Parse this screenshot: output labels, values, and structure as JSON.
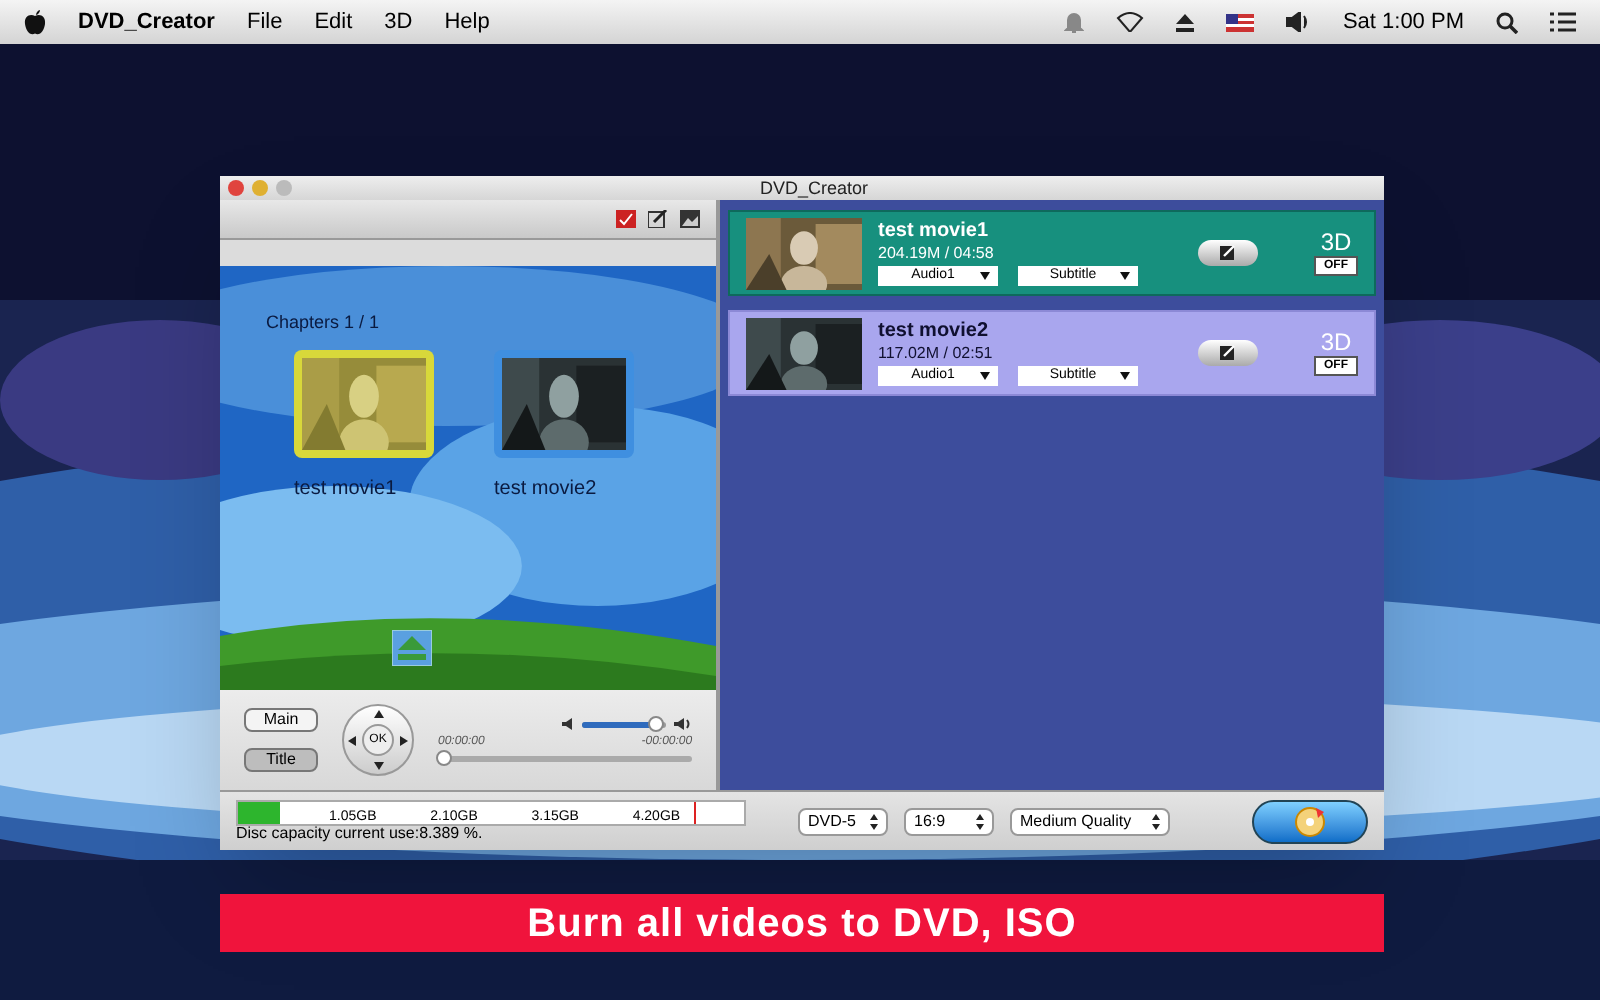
{
  "menu_bar": {
    "app_name": "DVD_Creator",
    "menus": [
      "File",
      "Edit",
      "3D",
      "Help"
    ],
    "clock": "Sat 1:00 PM"
  },
  "window": {
    "title": "DVD_Creator"
  },
  "preview": {
    "chapters": "Chapters 1 / 1",
    "thumbnails": [
      {
        "label": "test movie1",
        "selected": true
      },
      {
        "label": "test movie2",
        "selected": false
      }
    ]
  },
  "controls": {
    "buttons": [
      {
        "label": "Main",
        "selected": false
      },
      {
        "label": "Title",
        "selected": true
      }
    ],
    "ok": "OK",
    "volume": {
      "level": 0.88
    },
    "elapsed": "00:00:00",
    "remaining": "-00:00:00",
    "progress": {
      "level": 0
    }
  },
  "movies": [
    {
      "title": "test movie1",
      "info": "204.19M / 04:58",
      "audio": "Audio1",
      "subtitle": "Subtitle",
      "mode": "3D",
      "toggle": "OFF",
      "selected": true
    },
    {
      "title": "test movie2",
      "info": "117.02M / 02:51",
      "audio": "Audio1",
      "subtitle": "Subtitle",
      "mode": "3D",
      "toggle": "OFF",
      "selected": false
    }
  ],
  "disc": {
    "ticks": [
      "1.05GB",
      "2.10GB",
      "3.15GB",
      "4.20GB"
    ],
    "usage": {
      "level": 0.084
    },
    "caption": "Disc capacity current use:8.389 %."
  },
  "options": [
    "DVD-5",
    "16:9",
    "Medium Quality"
  ],
  "banner": "Burn all videos to DVD, ISO"
}
